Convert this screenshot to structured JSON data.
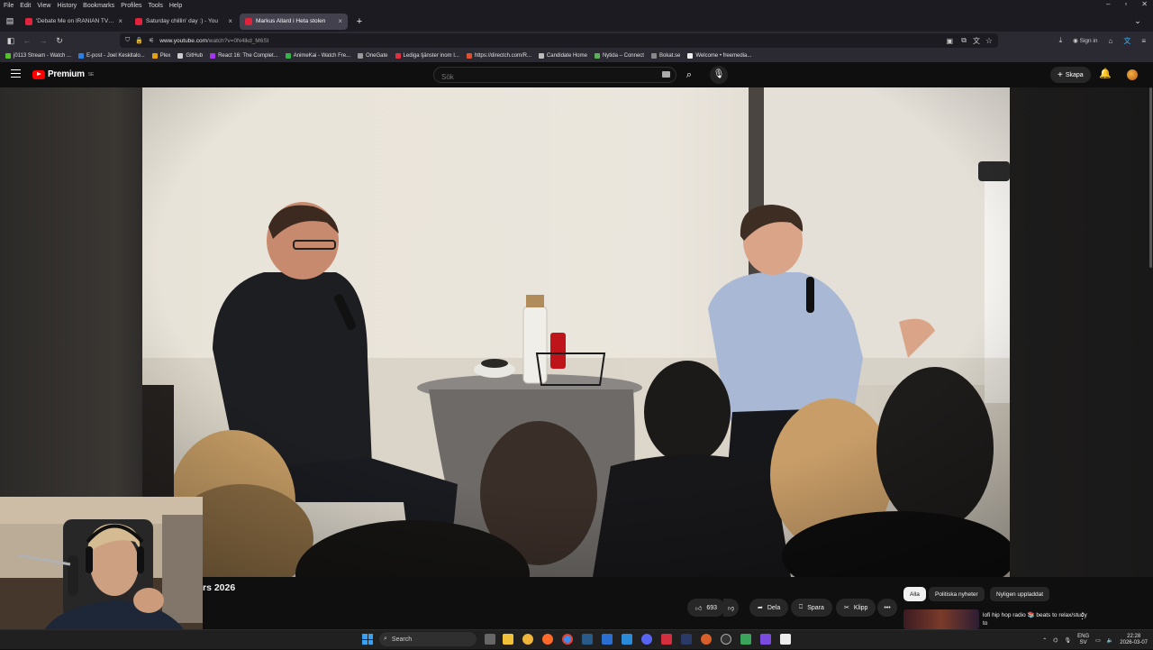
{
  "menubar": {
    "items": [
      "File",
      "Edit",
      "View",
      "History",
      "Bookmarks",
      "Profiles",
      "Tools",
      "Help"
    ],
    "window_controls": [
      "–",
      "▫",
      "✕"
    ]
  },
  "tabs": [
    {
      "title": "'Debate Me on IRANIAN TV!' In",
      "favicon_color": "#e0223a",
      "active": false
    },
    {
      "title": "Saturday chillin' day :) - You",
      "favicon_color": "#e0223a",
      "active": false
    },
    {
      "title": "Markus Allard i Heta stolen",
      "favicon_color": "#e0223a",
      "active": true
    }
  ],
  "navbar": {
    "url_host": "www.youtube.com",
    "url_path": "/watch?v=0N4lkd_M6SI",
    "signin_label": "Sign in"
  },
  "bookmarks": [
    {
      "label": "j0113 Stream - Watch ...",
      "color": "#53c22b"
    },
    {
      "label": "E-post - Joel Keskitalo...",
      "color": "#2f7de1"
    },
    {
      "label": "Plex",
      "color": "#e5a00d"
    },
    {
      "label": "GitHub",
      "color": "#cccccc"
    },
    {
      "label": "React 16: The Complet...",
      "color": "#a435f0"
    },
    {
      "label": "AnimeKai - Watch Fre...",
      "color": "#34b34a"
    },
    {
      "label": "OneGate",
      "color": "#999999"
    },
    {
      "label": "Lediga tjänster inom I...",
      "color": "#e03040"
    },
    {
      "label": "https://directch.com/R...",
      "color": "#e05030"
    },
    {
      "label": "Candidate Home",
      "color": "#bbbbbb"
    },
    {
      "label": "Nytida – Connect",
      "color": "#5bb05b"
    },
    {
      "label": "Bokat.se",
      "color": "#888888"
    },
    {
      "label": "Welcome • freemedia...",
      "color": "#eeeeee"
    }
  ],
  "youtube": {
    "logo_text": "Premium",
    "logo_region": "SE",
    "search_placeholder": "Sök",
    "create_label": "Skapa"
  },
  "video": {
    "title": "rs 2026",
    "likes": "693",
    "share_label": "Dela",
    "save_label": "Spara",
    "clip_label": "Klipp",
    "more_label": "•••"
  },
  "filter_chips": [
    {
      "label": "Alla",
      "active": true
    },
    {
      "label": "Politiska nyheter",
      "active": false
    },
    {
      "label": "Nyligen uppladdat",
      "active": false
    }
  ],
  "recommendation": {
    "title": "lofi hip hop radio 📚 beats to relax/study to"
  },
  "taskbar": {
    "search_label": "Search",
    "lang_top": "ENG",
    "lang_bottom": "SV",
    "time": "22:28",
    "date": "2026-03-07"
  }
}
